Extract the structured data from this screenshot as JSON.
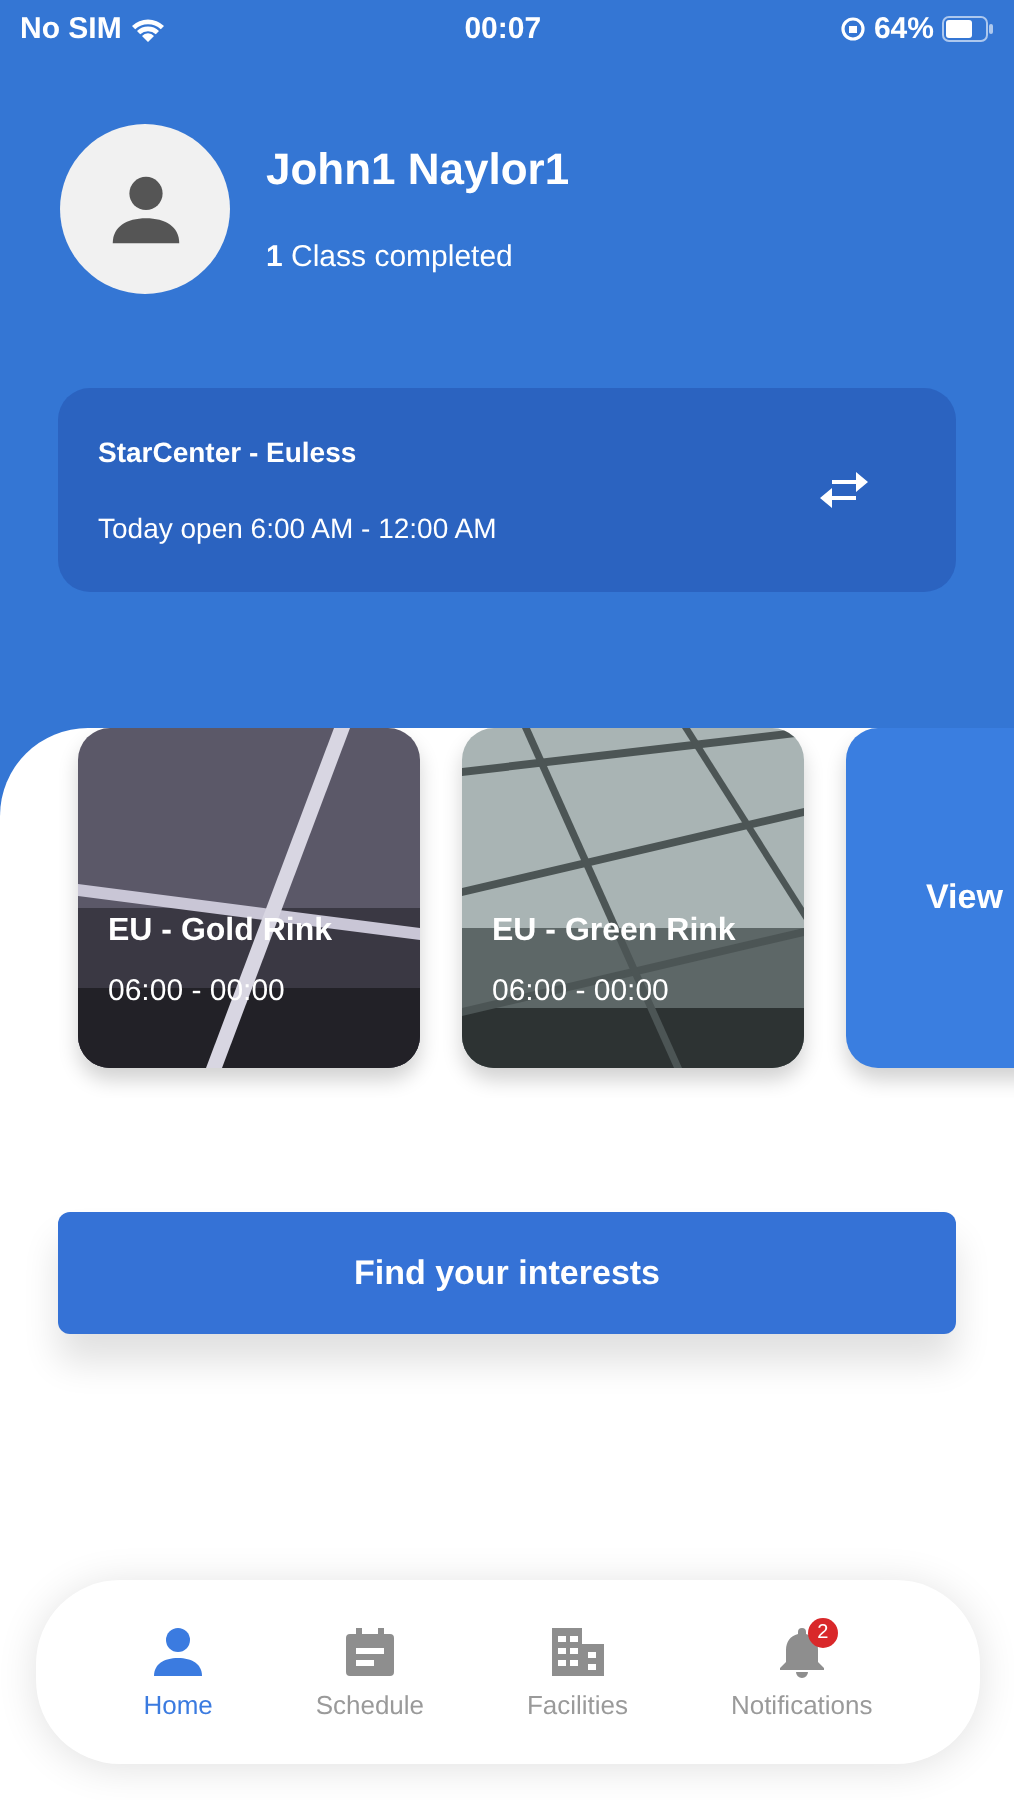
{
  "status_bar": {
    "carrier": "No SIM",
    "time": "00:07",
    "battery": "64%"
  },
  "profile": {
    "name": "John1 Naylor1",
    "classes_count": "1",
    "classes_label": "Class completed"
  },
  "location": {
    "name": "StarCenter - Euless",
    "hours": "Today open 6:00 AM - 12:00 AM"
  },
  "facilities": [
    {
      "kind": "rink",
      "name": "EU - Gold Rink",
      "hours": "06:00 - 00:00"
    },
    {
      "kind": "rink",
      "name": "EU - Green Rink",
      "hours": "06:00 - 00:00"
    },
    {
      "kind": "more",
      "name": "View"
    }
  ],
  "action_button": "Find your interests",
  "tabs": [
    {
      "label": "Home",
      "selected": true
    },
    {
      "label": "Schedule",
      "selected": false
    },
    {
      "label": "Facilities",
      "selected": false
    },
    {
      "label": "Notifications",
      "selected": false,
      "badge": "2"
    }
  ]
}
